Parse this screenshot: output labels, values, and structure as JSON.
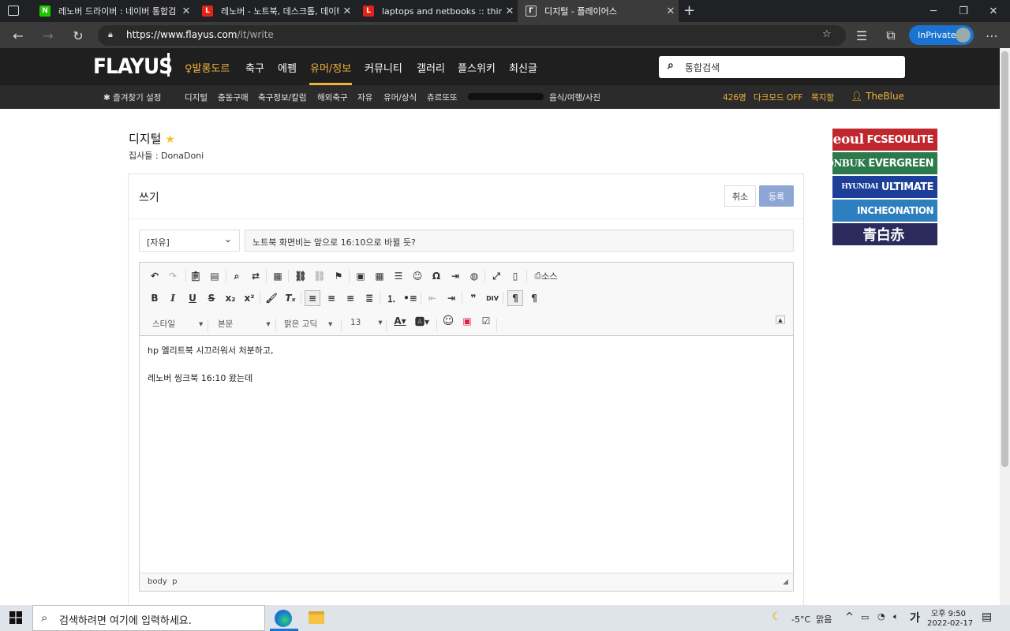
{
  "browser": {
    "tabs": [
      {
        "title": "레노버 드라이버 : 네이버 통합검",
        "icon": "naver-icon",
        "icon_color": "#1ec800",
        "icon_char": "N"
      },
      {
        "title": "레노버 - 노트북, 데스크톱, 데이터",
        "icon": "lenovo-icon",
        "icon_color": "#e2231a",
        "icon_char": "L"
      },
      {
        "title": "laptops and netbooks :: thinkboo",
        "icon": "lenovo-icon",
        "icon_color": "#e2231a",
        "icon_char": "L"
      },
      {
        "title": "디지털 - 플레이어스",
        "icon": "flayus-icon",
        "icon_color": "#444",
        "icon_char": "Γ"
      }
    ],
    "url_main": "https://www.flayus.com",
    "url_path": "/it/write",
    "inprivate": "InPrivate"
  },
  "site": {
    "logo": "FLAYUS",
    "nav": [
      "발롱도르",
      "축구",
      "에펨",
      "유머/정보",
      "커뮤니티",
      "갤러리",
      "플스위키",
      "최신글"
    ],
    "search_placeholder": "통합검색",
    "fav_settings": "즐겨찾기 설정",
    "subnav": [
      "디지털",
      "충동구매",
      "축구정보/칼럼",
      "해외축구",
      "자유",
      "유머/상식",
      "츄르또또",
      "음식/여행/사진"
    ],
    "online": "426명",
    "darkmode": "다크모드 OFF",
    "messages": "쪽지함",
    "user": "TheBlue"
  },
  "board": {
    "title": "디지털",
    "staff": "집사들 : DonaDoni",
    "write_label": "쓰기",
    "cancel": "취소",
    "submit": "등록",
    "category": "[자유]",
    "subject": "노트북 화면비는 앞으로 16:10으로 바뀔 듯?",
    "source": "소스",
    "style": "스타일",
    "format": "본문",
    "font": "맑은 고딕",
    "size": "13",
    "content_line1": "hp 엘리트북 시끄러워서 처분하고,",
    "content_line2": "레노버 씽크북 16:10 왔는데",
    "path": "body  p"
  },
  "banners": [
    {
      "big": "Seoul",
      "text": "FCSEOULITE",
      "color": "#c0262d"
    },
    {
      "big": "JEONBUK",
      "text": "EVERGREEN",
      "color": "#2b7a4b"
    },
    {
      "big": "HYUNDAI",
      "text": "ULTIMATE",
      "color": "#1d3f9a"
    },
    {
      "big": "",
      "text": "INCHEONATION",
      "color": "#2d7fc0"
    },
    {
      "big": "青白赤",
      "text": "",
      "color": "#2a2a5c"
    }
  ],
  "taskbar": {
    "search": "검색하려면 여기에 입력하세요.",
    "weather": "-5°C  맑음",
    "ime": "가",
    "time": "오후 9:50",
    "date": "2022-02-17"
  }
}
